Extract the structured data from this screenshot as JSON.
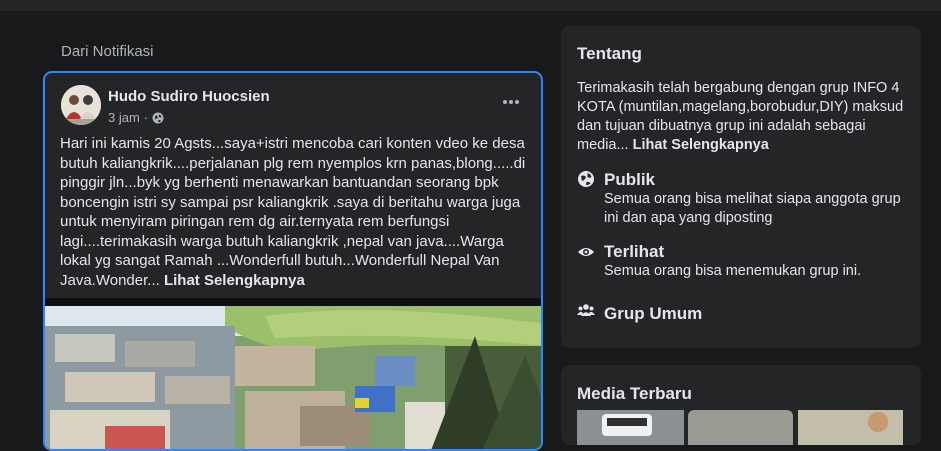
{
  "feed": {
    "section_label": "Dari Notifikasi"
  },
  "post": {
    "author": "Hudo Sudiro Huocsien",
    "time": "3 jam",
    "separator": "·",
    "text": "Hari ini kamis 20 Agsts...saya+istri mencoba cari konten vdeo ke desa butuh kaliangkrik....perjalanan plg rem nyemplos krn panas,blong.....di pinggir jln...byk yg berhenti menawarkan bantuandan seorang bpk boncengin istri sy sampai psr kaliangkrik .saya di beritahu warga juga untuk menyiram piringan rem dg air.ternyata rem berfungsi lagi....terimakasih warga butuh kaliangkrik ,nepal van java....Warga lokal yg sangat Ramah ...Wonderfull butuh...Wonderfull Nepal Van Java.Wonder...",
    "see_more": "Lihat Selengkapnya",
    "more_icon": "more-dots-icon",
    "privacy_icon": "globe-icon"
  },
  "about": {
    "title": "Tentang",
    "description": "Terimakasih telah bergabung dengan grup INFO 4 KOTA (muntilan,magelang,borobudur,DIY) maksud dan tujuan dibuatnya grup ini adalah sebagai media...",
    "see_more": "Lihat Selengkapnya",
    "public": {
      "icon": "globe-icon",
      "title": "Publik",
      "desc": "Semua orang bisa melihat siapa anggota grup ini dan apa yang diposting"
    },
    "visible": {
      "icon": "eye-icon",
      "title": "Terlihat",
      "desc": "Semua orang bisa menemukan grup ini."
    },
    "general": {
      "icon": "group-icon",
      "title": "Grup Umum"
    }
  },
  "media": {
    "title": "Media Terbaru"
  },
  "colors": {
    "page_bg": "#18191a",
    "card_bg": "#242526",
    "focus_border": "#2d88ff",
    "primary_text": "#e4e6eb",
    "secondary_text": "#b0b3b8"
  }
}
